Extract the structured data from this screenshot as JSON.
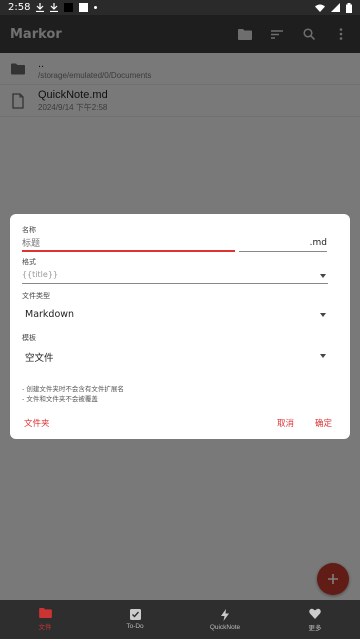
{
  "status_bar": {
    "time": "2:58"
  },
  "app_bar": {
    "title": "Markor"
  },
  "files": [
    {
      "name": "..",
      "path": "/storage/emulated/0/Documents",
      "icon": "folder-icon"
    },
    {
      "name": "QuickNote.md",
      "path": "2024/9/14 下午2:58",
      "icon": "document-icon"
    }
  ],
  "dialog": {
    "name_label": "名称",
    "name_placeholder": "标题",
    "extension": ".md",
    "format_label": "格式",
    "format_value": "{{title}}",
    "file_type_label": "文件类型",
    "file_type_value": "Markdown",
    "template_label": "模板",
    "template_value": "空文件",
    "hints": [
      "- 创建文件夹时不会含有文件扩展名",
      "- 文件和文件夹不会被覆盖"
    ],
    "folder_button": "文件夹",
    "cancel_button": "取消",
    "ok_button": "确定"
  },
  "bottom_nav": [
    {
      "label": "文件",
      "icon": "folder-icon",
      "active": true
    },
    {
      "label": "To-Do",
      "icon": "checkbox-icon",
      "active": false
    },
    {
      "label": "QuickNote",
      "icon": "lightning-icon",
      "active": false
    },
    {
      "label": "更多",
      "icon": "heart-icon",
      "active": false
    }
  ],
  "colors": {
    "accent": "#c0392b",
    "appbar": "#3c3c3c",
    "nav": "#2e2e2e"
  }
}
